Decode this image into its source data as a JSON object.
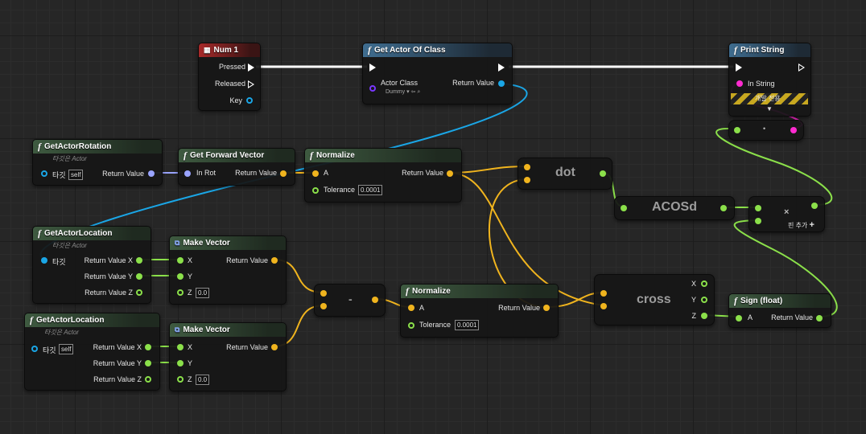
{
  "nodes": {
    "num1": {
      "title": "Num 1",
      "pressed": "Pressed",
      "released": "Released",
      "key": "Key"
    },
    "get_actor_of_class": {
      "title": "Get Actor Of Class",
      "actor_class": "Actor Class",
      "class_value": "Dummy",
      "return_value": "Return Value"
    },
    "print_string": {
      "title": "Print String",
      "in_string": "In String",
      "dev_only": "개발 전용"
    },
    "get_actor_rotation": {
      "title": "GetActorRotation",
      "subtitle": "타깃은 Actor",
      "target": "타깃",
      "target_value": "self",
      "return_value": "Return Value"
    },
    "get_forward_vector": {
      "title": "Get Forward Vector",
      "in_rot": "In Rot",
      "return_value": "Return Value"
    },
    "normalize_1": {
      "title": "Normalize",
      "a": "A",
      "return_value": "Return Value",
      "tolerance": "Tolerance",
      "tolerance_value": "0.0001"
    },
    "dot": {
      "title": "dot"
    },
    "acosd": {
      "title": "ACOSd"
    },
    "multiply": {
      "title": "×",
      "add_pin": "핀 추가"
    },
    "get_actor_location_1": {
      "title": "GetActorLocation",
      "subtitle": "타깃은 Actor",
      "target": "타깃",
      "return_x": "Return Value X",
      "return_y": "Return Value Y",
      "return_z": "Return Value Z"
    },
    "make_vector_1": {
      "title": "Make Vector",
      "x": "X",
      "y": "Y",
      "z": "Z",
      "z_value": "0.0",
      "return_value": "Return Value"
    },
    "get_actor_location_2": {
      "title": "GetActorLocation",
      "subtitle": "타깃은 Actor",
      "target": "타깃",
      "target_value": "self",
      "return_x": "Return Value X",
      "return_y": "Return Value Y",
      "return_z": "Return Value Z"
    },
    "make_vector_2": {
      "title": "Make Vector",
      "x": "X",
      "y": "Y",
      "z": "Z",
      "z_value": "0.0",
      "return_value": "Return Value"
    },
    "subtract": {
      "title": "-"
    },
    "normalize_2": {
      "title": "Normalize",
      "a": "A",
      "return_value": "Return Value",
      "tolerance": "Tolerance",
      "tolerance_value": "0.0001"
    },
    "cross": {
      "title": "cross",
      "x": "X",
      "y": "Y",
      "z": "Z"
    },
    "sign_float": {
      "title": "Sign (float)",
      "a": "A",
      "return_value": "Return Value"
    },
    "conversion": {
      "title": "•"
    }
  },
  "colors": {
    "vector_pin": "#f0b41e",
    "float_pin": "#8be04a",
    "object_pin": "#1aa6e6",
    "string_pin": "#ff2bd0",
    "rotator_pin": "#9aa4ff",
    "class_pin": "#7a37ff",
    "exec_wire": "#ffffff",
    "function_header": "#3e5a40",
    "pure_blue_header": "#3f6d90",
    "event_header": "#a82a2a"
  },
  "icons": {
    "function": "function-f-icon",
    "event": "keyboard-event-icon",
    "exec": "exec-arrow-icon"
  }
}
